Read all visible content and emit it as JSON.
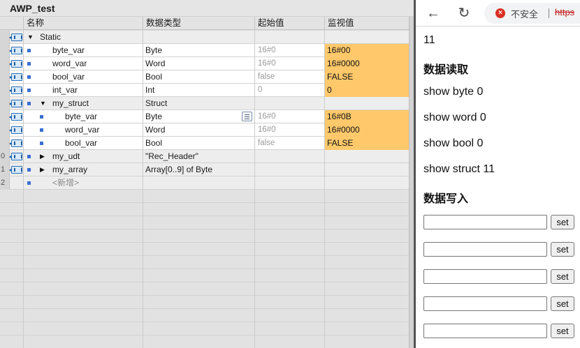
{
  "window": {
    "title": "AWP_test"
  },
  "table": {
    "columns": [
      "名称",
      "数据类型",
      "起始值",
      "监视值"
    ],
    "rows": [
      {
        "gutter": "",
        "name": "Static",
        "type": "",
        "start": "",
        "monitor": "",
        "expander": "▼"
      },
      {
        "gutter": "",
        "name": "byte_var",
        "type": "Byte",
        "start": "16#0",
        "monitor": "16#00"
      },
      {
        "gutter": "",
        "name": "word_var",
        "type": "Word",
        "start": "16#0",
        "monitor": "16#0000"
      },
      {
        "gutter": "",
        "name": "bool_var",
        "type": "Bool",
        "start": "false",
        "monitor": "FALSE"
      },
      {
        "gutter": "",
        "name": "int_var",
        "type": "Int",
        "start": "0",
        "monitor": "0"
      },
      {
        "gutter": "",
        "name": "my_struct",
        "type": "Struct",
        "start": "",
        "monitor": "",
        "expander": "▼"
      },
      {
        "gutter": "",
        "name": "byte_var",
        "type": "Byte",
        "start": "16#0",
        "monitor": "16#0B"
      },
      {
        "gutter": "",
        "name": "word_var",
        "type": "Word",
        "start": "16#0",
        "monitor": "16#0000"
      },
      {
        "gutter": "",
        "name": "bool_var",
        "type": "Bool",
        "start": "false",
        "monitor": "FALSE"
      },
      {
        "gutter": "0",
        "name": "my_udt",
        "type": "\"Rec_Header\"",
        "start": "",
        "monitor": "",
        "expander": "▶"
      },
      {
        "gutter": "1",
        "name": "my_array",
        "type": "Array[0..9] of Byte",
        "start": "",
        "monitor": "",
        "expander": "▶"
      },
      {
        "gutter": "2",
        "name": "<新增>",
        "type": "",
        "start": "",
        "monitor": ""
      }
    ]
  },
  "browser": {
    "insecure_label": "不安全",
    "url_prefix": "https",
    "colors": {
      "warning": "#d93025",
      "monitor_highlight": "#ffc96b"
    }
  },
  "page": {
    "value_line": "11",
    "read_heading": "数据读取",
    "show_byte": "show byte 0",
    "show_word": "show word 0",
    "show_bool": "show bool 0",
    "show_struct": "show struct 11",
    "write_heading": "数据写入",
    "set_label": "set"
  }
}
